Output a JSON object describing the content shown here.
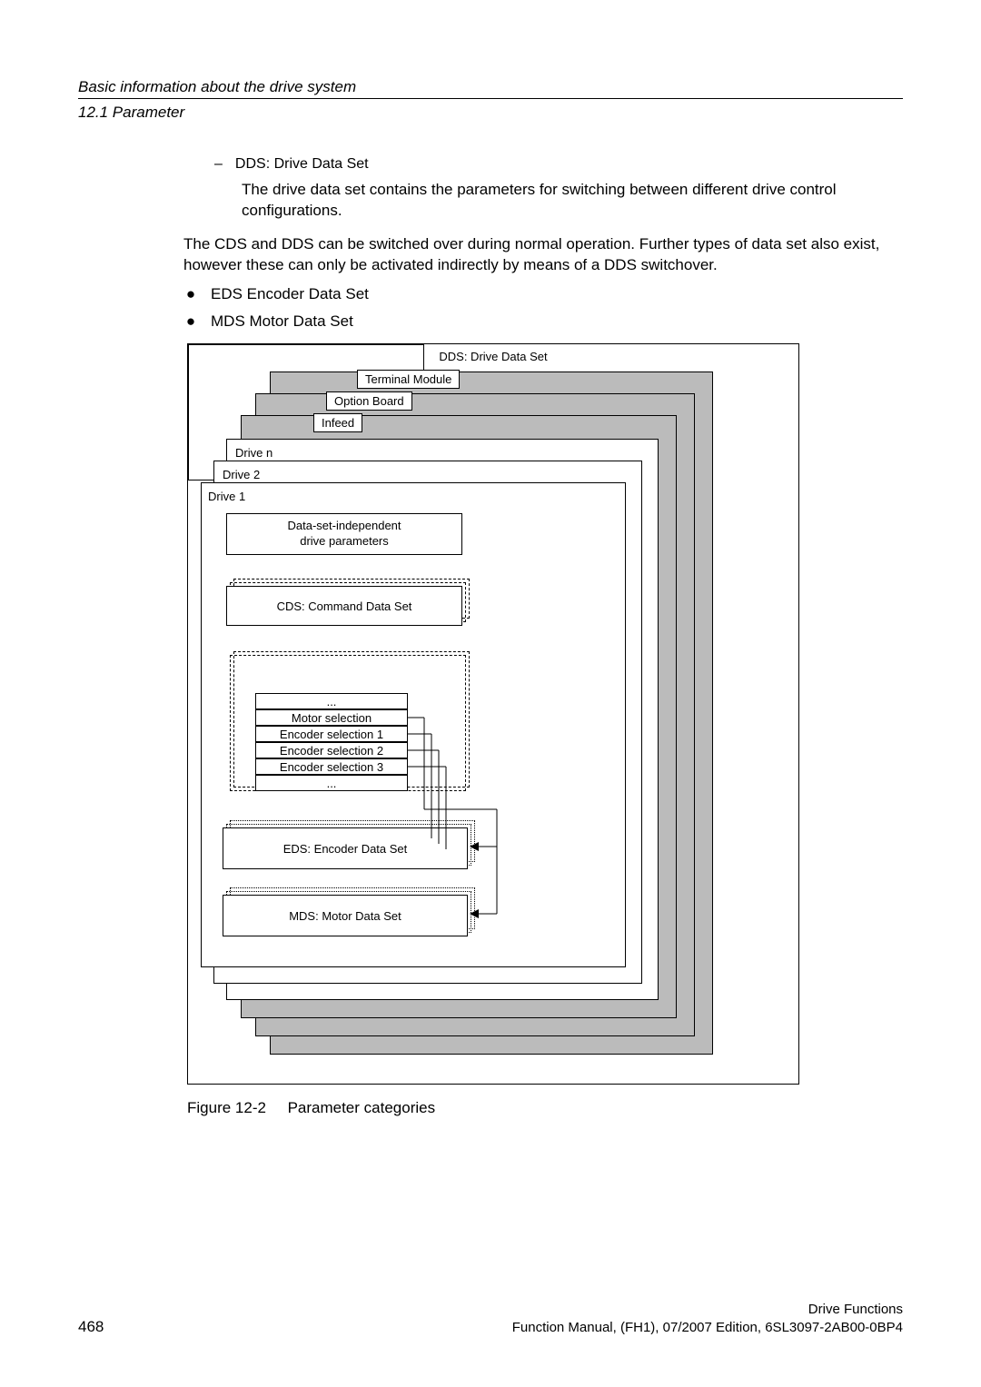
{
  "header": {
    "chapter": "Basic information about the drive system",
    "section": "12.1 Parameter"
  },
  "content": {
    "dds_label": "DDS: Drive Data Set",
    "dds_desc": "The drive data set contains the parameters for switching between different drive control configurations.",
    "switch_para": "The CDS and DDS can be switched over during normal operation. Further types of data set also exist, however these can only be activated indirectly by means of a DDS switchover.",
    "bullet_eds": "EDS Encoder Data Set",
    "bullet_mds": "MDS Motor Data Set"
  },
  "diagram": {
    "tabs": {
      "terminal_module": "Terminal Module",
      "option_board": "Option Board",
      "infeed": "Infeed"
    },
    "labels": {
      "drive_n": "Drive n",
      "drive_2": "Drive 2",
      "drive_1": "Drive 1"
    },
    "boxes": {
      "indep_l1": "Data-set-independent",
      "indep_l2": "drive parameters",
      "cds": "CDS: Command Data Set",
      "dds_title": "DDS: Drive Data Set",
      "dds_rows": {
        "r0": "...",
        "r1": "Motor selection",
        "r2": "Encoder selection 1",
        "r3": "Encoder selection 2",
        "r4": "Encoder selection 3",
        "r5": "..."
      },
      "eds": "EDS: Encoder Data Set",
      "mds": "MDS: Motor Data Set"
    }
  },
  "figure_caption_num": "Figure 12-2",
  "figure_caption_text": "Parameter categories",
  "footer": {
    "page": "468",
    "right_l1": "Drive Functions",
    "right_l2": "Function Manual, (FH1), 07/2007 Edition, 6SL3097-2AB00-0BP4"
  }
}
